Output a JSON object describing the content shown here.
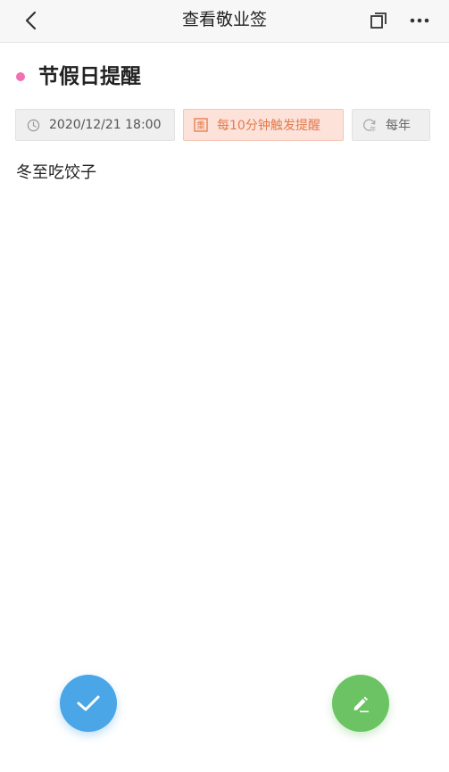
{
  "header": {
    "title": "查看敬业签",
    "back_icon": "chevron-left-icon",
    "copy_icon": "copy-icon",
    "more_icon": "more-dots-icon"
  },
  "note": {
    "title": "节假日提醒",
    "dot_color": "#f26fb4",
    "reminder_time": "2020/12/21 18:00",
    "repeat_badge_glyph": "重",
    "repeat_label": "每10分钟触发提醒",
    "cycle_glyph": "年",
    "cycle_label": "每年",
    "content": "冬至吃饺子"
  },
  "actions": {
    "done_icon": "check-icon",
    "edit_icon": "pencil-icon"
  },
  "colors": {
    "repeat_text": "#e27a4d",
    "repeat_bg": "#fde2d9",
    "done_button": "#4aa6e6",
    "edit_button": "#6cc364"
  }
}
